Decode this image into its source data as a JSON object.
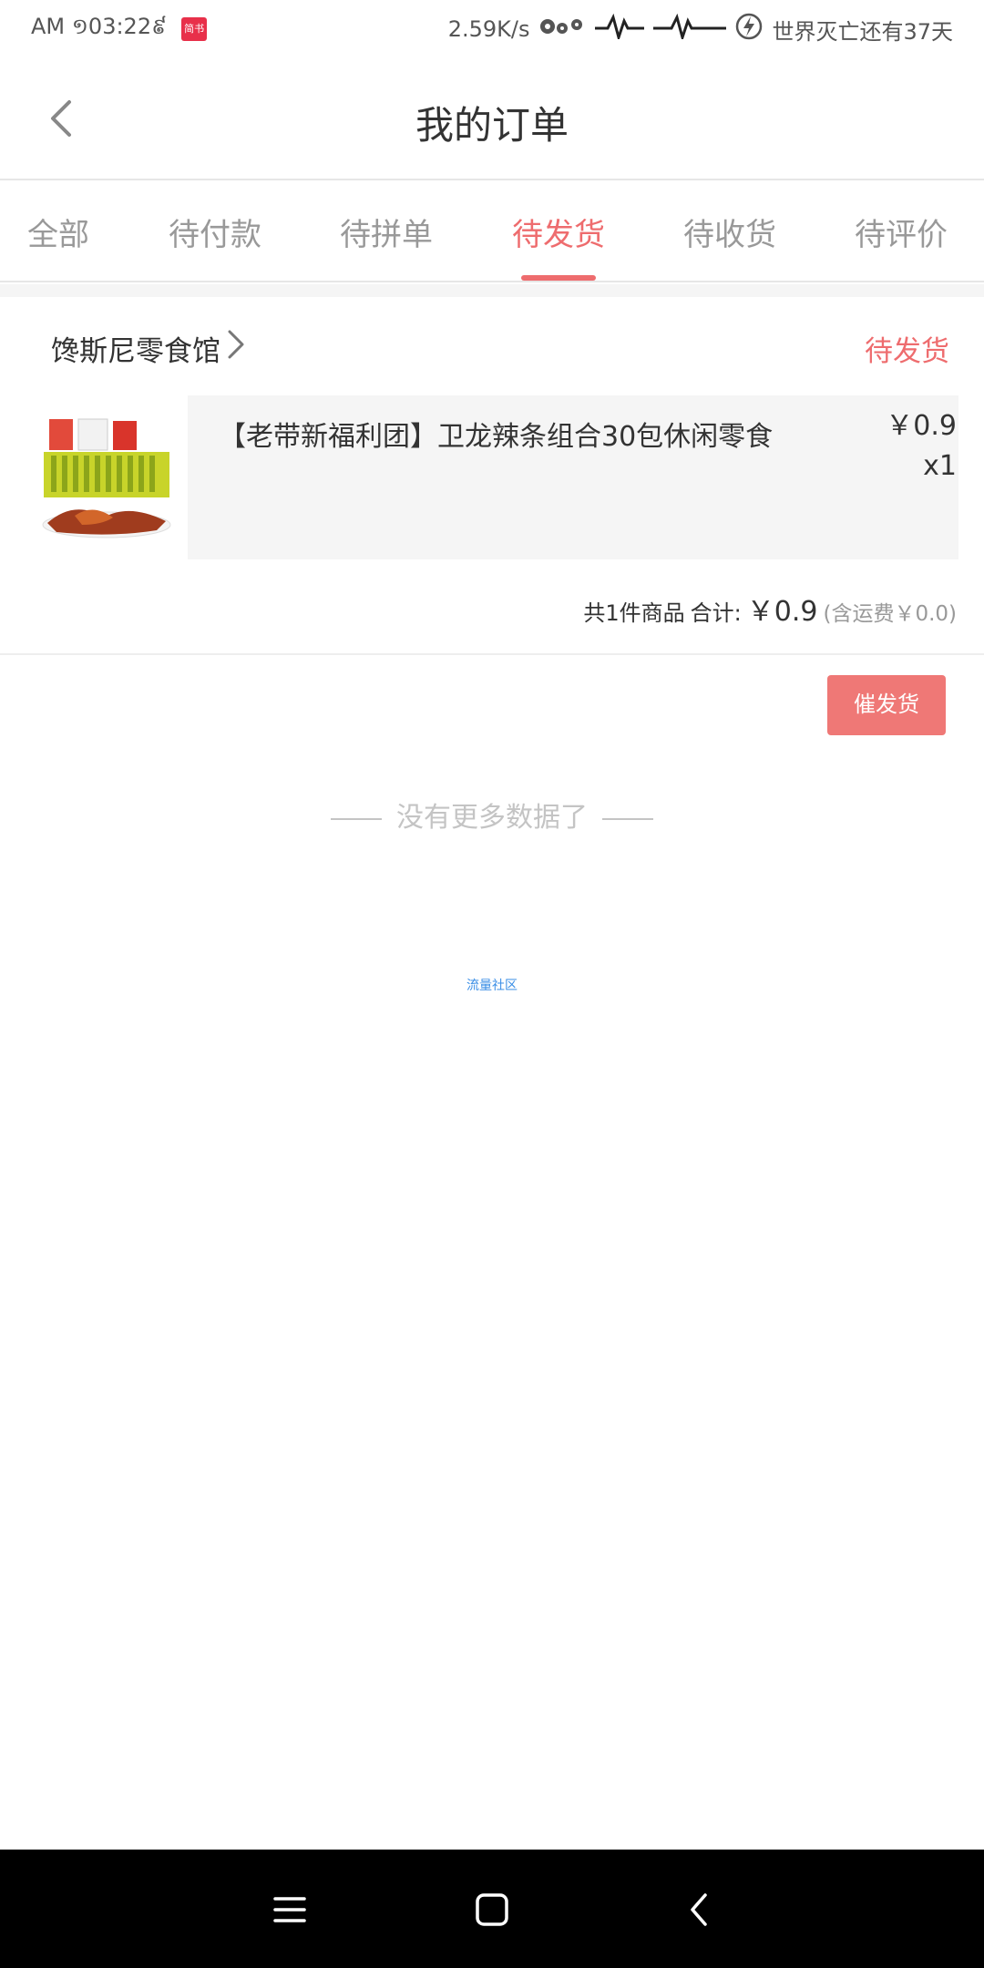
{
  "status_bar": {
    "time": "AM ១03:22៩",
    "app_badge": "简书",
    "net_speed": "2.59K/s",
    "doom_text": "世界灭亡还有37天",
    "icons": [
      "flower-icon",
      "pulse-icon",
      "pulse-long-icon",
      "lightning-icon"
    ]
  },
  "header": {
    "title": "我的订单",
    "back_icon": "chevron-left-icon"
  },
  "tabs": [
    {
      "label": "全部",
      "active": false
    },
    {
      "label": "待付款",
      "active": false
    },
    {
      "label": "待拼单",
      "active": false
    },
    {
      "label": "待发货",
      "active": true
    },
    {
      "label": "待收货",
      "active": false
    },
    {
      "label": "待评价",
      "active": false
    }
  ],
  "order": {
    "shop_name": "馋斯尼零食馆",
    "status": "待发货",
    "item": {
      "name": "【老带新福利团】卫龙辣条组合30包休闲零食",
      "price": "￥0.9",
      "quantity": "x1"
    },
    "summary": {
      "count_text": "共1件商品",
      "total_label": "合计:",
      "total": "￥0.9",
      "shipping": "(含运费￥0.0)"
    },
    "action_button": "催发货"
  },
  "no_more_text": "没有更多数据了",
  "community_link": "流量社区",
  "nav_bar": {
    "icons": [
      "menu-icon",
      "home-icon",
      "back-icon"
    ]
  },
  "colors": {
    "accent": "#ee6c6e",
    "button": "#ef7876",
    "muted_text": "#999999",
    "link": "#3a8ee6"
  }
}
